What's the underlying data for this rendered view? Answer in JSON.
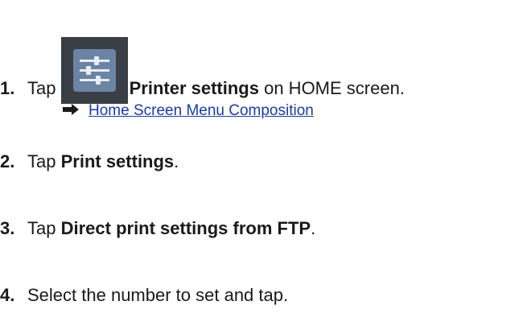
{
  "steps": [
    {
      "number": "1.",
      "before": "Tap",
      "icon": "printer-settings-icon",
      "bold": "Printer settings",
      "after": " on HOME screen."
    },
    {
      "number": "2.",
      "before": "Tap ",
      "bold": "Print settings",
      "after": "."
    },
    {
      "number": "3.",
      "before": "Tap ",
      "bold": "Direct print settings from FTP",
      "after": "."
    },
    {
      "number": "4.",
      "text": "Select the number to set and tap."
    }
  ],
  "link": {
    "icon": "right-arrow-icon",
    "label": "Home Screen Menu Composition"
  },
  "colors": {
    "text": "#1a1a1a",
    "link": "#1a3ba8",
    "icon_bg": "#3a3f45",
    "icon_fg": "#e6edf5"
  }
}
